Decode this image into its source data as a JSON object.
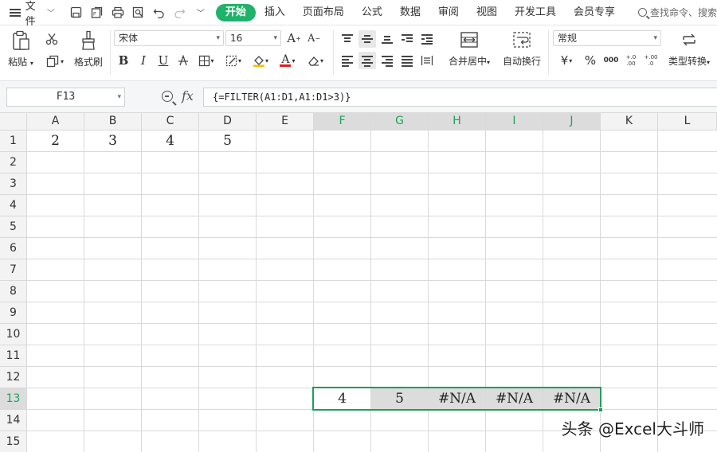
{
  "menubar": {
    "file_label": "文件",
    "tabs": [
      {
        "label": "开始",
        "active": true
      },
      {
        "label": "插入"
      },
      {
        "label": "页面布局"
      },
      {
        "label": "公式"
      },
      {
        "label": "数据"
      },
      {
        "label": "审阅"
      },
      {
        "label": "视图"
      },
      {
        "label": "开发工具"
      },
      {
        "label": "会员专享"
      }
    ],
    "search_label": "查找命令、搜索"
  },
  "ribbon": {
    "paste_label": "粘贴",
    "format_painter_label": "格式刷",
    "font_name": "宋体",
    "font_size": "16",
    "merge_center_label": "合并居中",
    "wrap_text_label": "自动换行",
    "number_format": "常规",
    "type_convert_label": "类型转换",
    "currency_symbol": "¥",
    "percent_symbol": "%",
    "thousands_symbol": "000",
    "dec_inc_symbol": "+.0 .00",
    "dec_dec_symbol": "+.00 .0",
    "bold": "B",
    "italic": "I",
    "underline": "U",
    "font_color_letter": "A"
  },
  "formula_bar": {
    "name_box": "F13",
    "fx_label": "fx",
    "formula": "{=FILTER(A1:D1,A1:D1>3)}"
  },
  "grid": {
    "columns": [
      "A",
      "B",
      "C",
      "D",
      "E",
      "F",
      "G",
      "H",
      "I",
      "J",
      "K",
      "L"
    ],
    "rows": [
      "1",
      "2",
      "3",
      "4",
      "5",
      "6",
      "7",
      "8",
      "9",
      "10",
      "11",
      "12",
      "13",
      "14",
      "15"
    ],
    "cells": {
      "A1": "2",
      "B1": "3",
      "C1": "4",
      "D1": "5",
      "F13": "4",
      "G13": "5",
      "H13": "#N/A",
      "I13": "#N/A",
      "J13": "#N/A"
    },
    "active_cell": "F13"
  },
  "watermark": "头条 @Excel大斗师",
  "colors": {
    "accent": "#1fb26b",
    "selection_border": "#1e9e5a",
    "spill_fill": "#dcdcdc"
  }
}
